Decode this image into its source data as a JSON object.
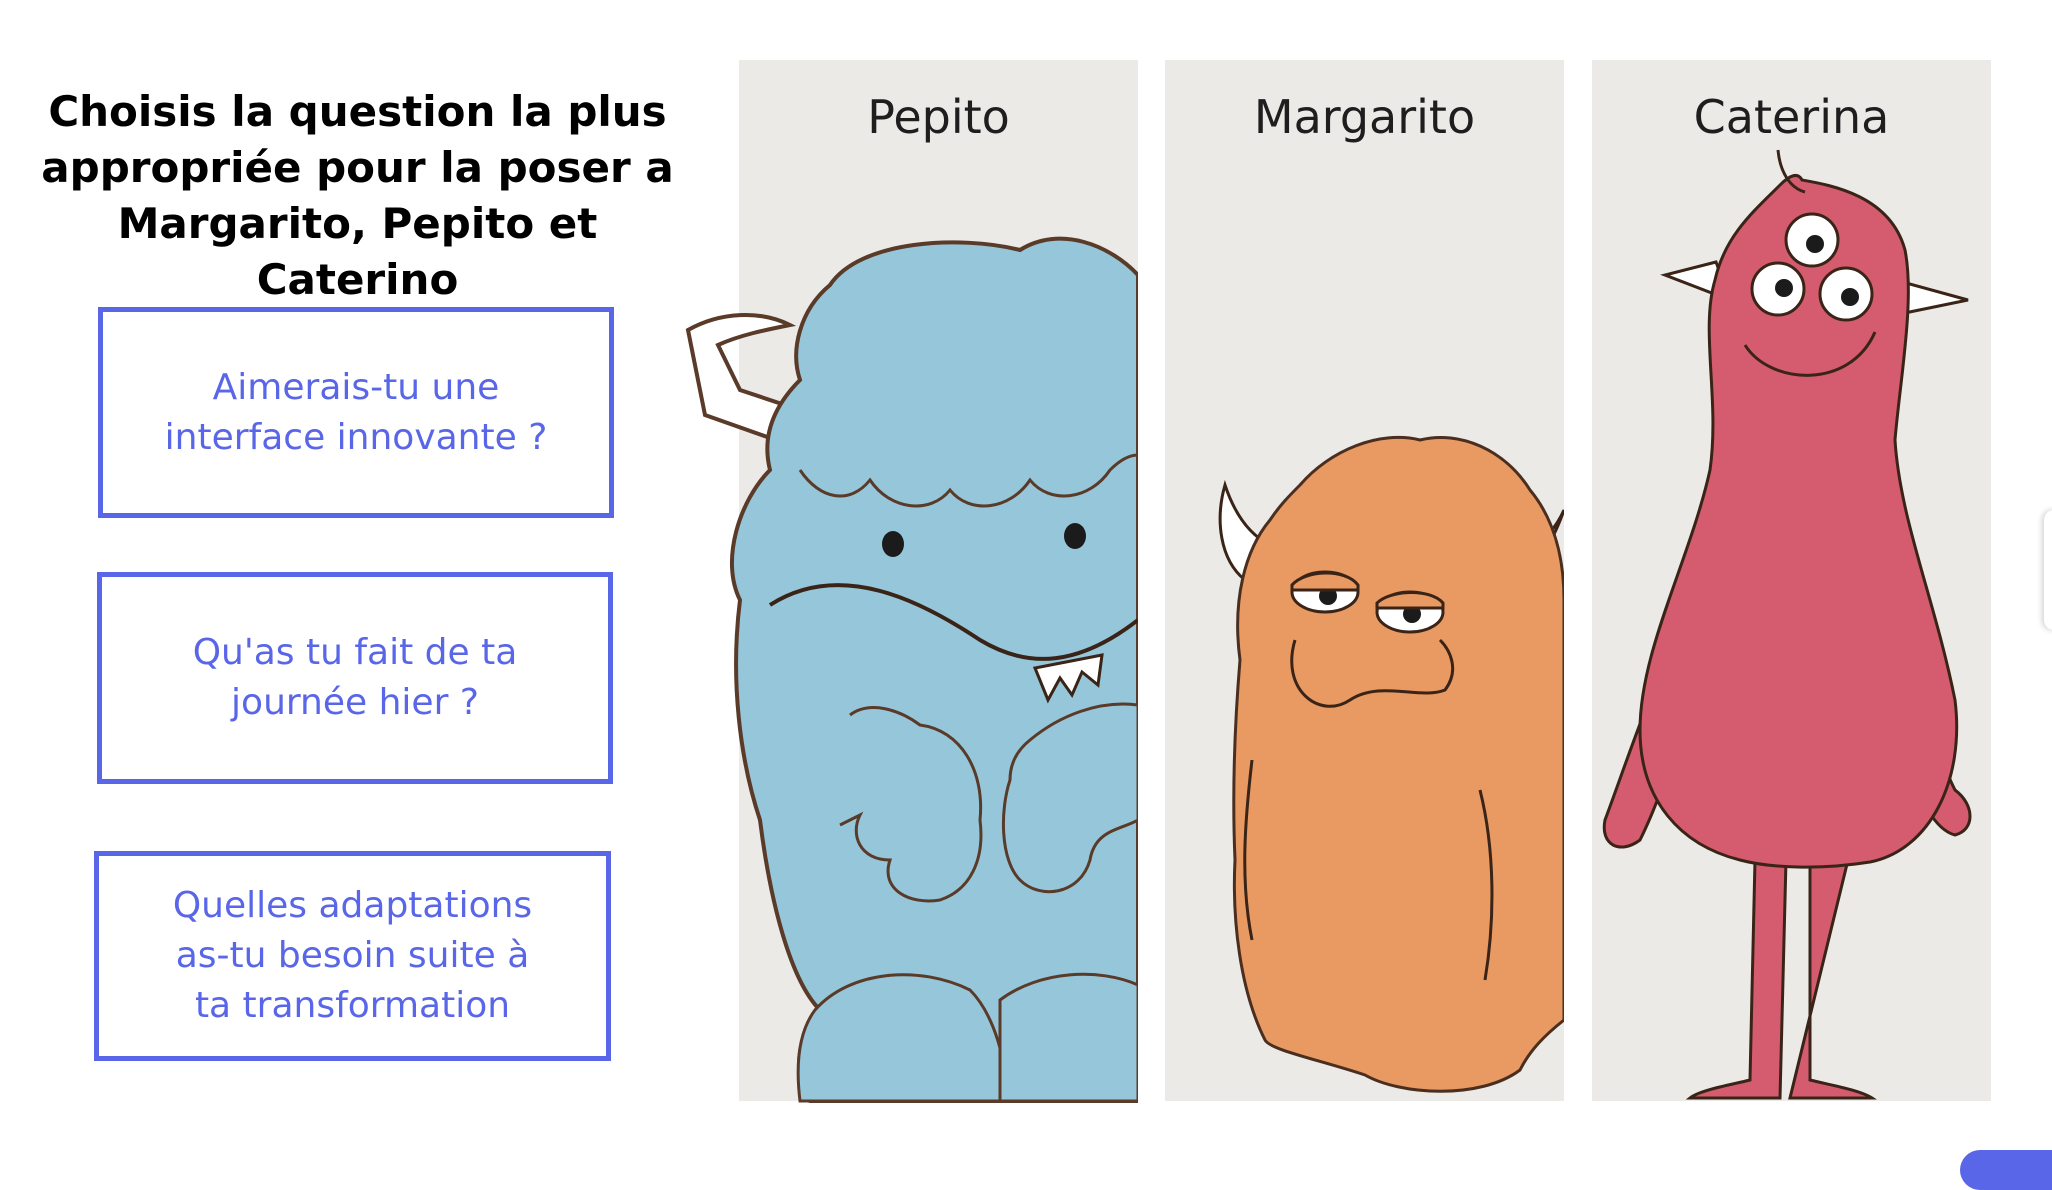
{
  "question": {
    "title": "Choisis la question la plus\nappropriée pour la poser a\nMargarito, Pepito et Caterino"
  },
  "options": [
    {
      "label": "Aimerais-tu une\ninterface innovante ?"
    },
    {
      "label": "Qu'as tu fait de ta\njournée hier ?"
    },
    {
      "label": "Quelles adaptations\nas-tu besoin suite à\nta transformation"
    }
  ],
  "characters": [
    {
      "name": "Pepito",
      "illustration": "blue-furry-monster-icon",
      "color": "#96c6da"
    },
    {
      "name": "Margarito",
      "illustration": "orange-furry-monster-icon",
      "color": "#e89a62"
    },
    {
      "name": "Caterina",
      "illustration": "pink-three-eyed-monster-icon",
      "color": "#d45c6e"
    }
  ],
  "colors": {
    "accent": "#5966e8",
    "panel_background": "#ebeae7",
    "outline": "#5a3a28"
  }
}
